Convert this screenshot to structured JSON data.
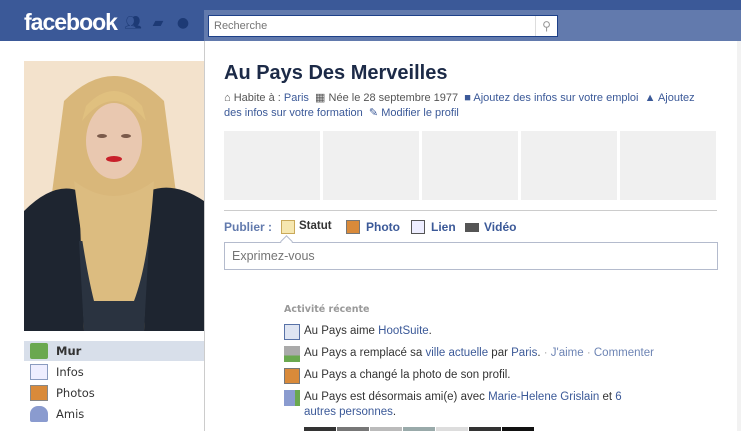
{
  "header": {
    "logo": "facebook",
    "search_placeholder": "Recherche"
  },
  "sidebar": {
    "items": [
      {
        "label": "Mur",
        "selected": true
      },
      {
        "label": "Infos"
      },
      {
        "label": "Photos"
      },
      {
        "label": "Amis"
      }
    ]
  },
  "profile": {
    "name": "Au Pays Des Merveilles",
    "lives_in_label": "Habite à : ",
    "lives_in": "Paris",
    "birth": "Née le 28 septembre 1977",
    "add_work": "Ajoutez des infos sur votre emploi",
    "add_edu": "Ajoutez des infos sur votre formation",
    "edit": "Modifier le profil"
  },
  "publisher": {
    "label": "Publier :",
    "items": [
      "Statut",
      "Photo",
      "Lien",
      "Vidéo"
    ],
    "placeholder": "Exprimez-vous"
  },
  "activity": {
    "title": "Activité récente",
    "items": [
      {
        "a": "Au Pays aime ",
        "l1": "HootSuite",
        "b": "."
      },
      {
        "a": "Au Pays a remplacé sa ",
        "l1": "ville actuelle",
        "b": " par ",
        "l2": "Paris",
        "c": ".",
        "like": "J'aime",
        "comment": "Commenter"
      },
      {
        "a": "Au Pays a changé la photo de son profil."
      },
      {
        "a": "Au Pays est désormais ami(e) avec ",
        "l1": "Marie-Helene Grislain",
        "b": " et ",
        "l2": "6 autres personnes",
        "c": "."
      }
    ]
  },
  "colors": {
    "brand": "#3b5998",
    "link": "#3b5998",
    "selected": "#d8dfea"
  }
}
